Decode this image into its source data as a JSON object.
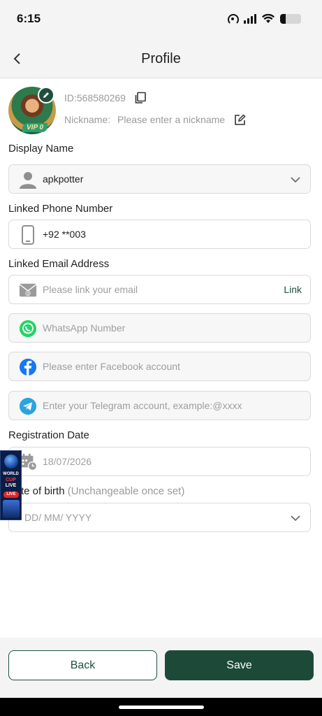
{
  "status": {
    "time": "6:15",
    "battery_level": 0.25
  },
  "header": {
    "title": "Profile",
    "back_icon": "chevron-left-icon"
  },
  "profile": {
    "id_text": "ID:568580269",
    "vip_badge": "VIP 0",
    "nickname_label": "Nickname:",
    "nickname_placeholder": "Please enter a nickname"
  },
  "sections": {
    "display_name": "Display Name",
    "linked_phone": "Linked Phone Number",
    "linked_email": "Linked Email Address",
    "registration_date": "Registration Date",
    "dob": "te of birth",
    "dob_note": "(Unchangeable once set)"
  },
  "fields": {
    "display_name_value": "apkpotter",
    "phone_value": "+92 **003",
    "email_placeholder": "Please link your email",
    "email_link": "Link",
    "whatsapp_placeholder": "WhatsApp Number",
    "facebook_placeholder": "Please enter Facebook account",
    "telegram_placeholder": "Enter your Telegram account, example:@xxxx",
    "registration_value": "18/07/2026",
    "dob_placeholder": "DD/ MM/ YYYY"
  },
  "floating_banner": {
    "line1": "WORLD",
    "line2": "CUP",
    "line3": "LIVE",
    "live_badge": "LIVE"
  },
  "buttons": {
    "back": "Back",
    "save": "Save"
  },
  "colors": {
    "primary": "#1d4a38",
    "whatsapp": "#25d366",
    "facebook": "#1877f2",
    "telegram": "#2aa3e0"
  }
}
